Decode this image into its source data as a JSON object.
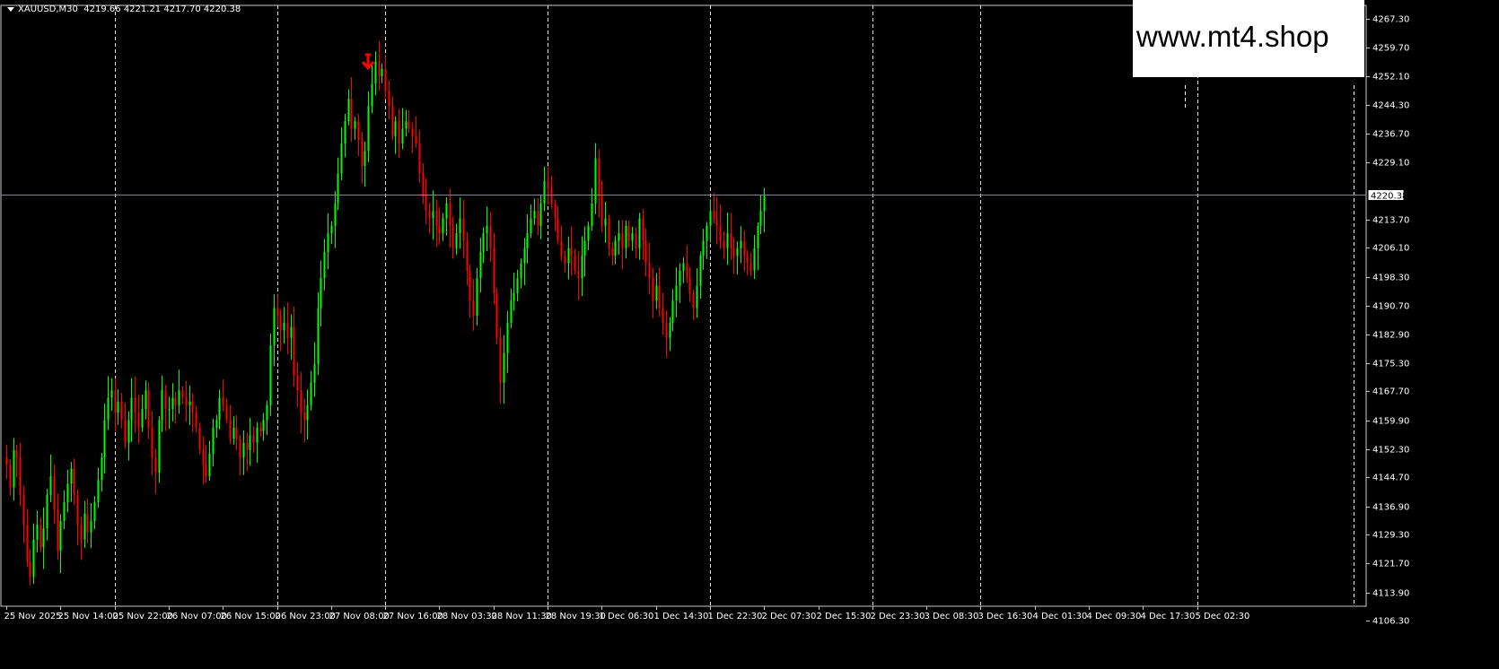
{
  "header": {
    "symbol": "XAUUSD,M30",
    "ohlc": "4219.66 4221.21 4217.70 4220.38"
  },
  "watermark": {
    "text": "www.mt4.shop"
  },
  "colors": {
    "background": "#000000",
    "bull": "#00ff00",
    "bear": "#ff0000",
    "grid": "#ffffff",
    "bid_line": "#778899",
    "axis_text": "#ffffff",
    "arrow": "#ff0000"
  },
  "chart_data": {
    "type": "candlestick",
    "symbol": "XAUUSD",
    "timeframe": "M30",
    "current_price": 4220.38,
    "current_price_label": "4220.38",
    "ylim": [
      4110.2,
      4271.0
    ],
    "grid": "vertical-dashed",
    "y_ticks": [
      "4267.30",
      "4259.70",
      "4252.10",
      "4244.30",
      "4236.70",
      "4229.10",
      "4213.70",
      "4206.10",
      "4198.30",
      "4190.70",
      "4182.90",
      "4175.30",
      "4167.70",
      "4159.90",
      "4152.30",
      "4144.70",
      "4136.90",
      "4129.30",
      "4121.70",
      "4113.90",
      "4106.30"
    ],
    "x_ticks": [
      "25 Nov 2025",
      "25 Nov 14:00",
      "25 Nov 22:00",
      "26 Nov 07:00",
      "26 Nov 15:00",
      "26 Nov 23:00",
      "27 Nov 08:00",
      "27 Nov 16:00",
      "28 Nov 03:30",
      "28 Nov 11:30",
      "28 Nov 19:30",
      "1 Dec 06:30",
      "1 Dec 14:30",
      "1 Dec 22:30",
      "2 Dec 07:30",
      "2 Dec 15:30",
      "2 Dec 23:30",
      "3 Dec 08:30",
      "3 Dec 16:30",
      "4 Dec 01:30",
      "4 Dec 09:30",
      "4 Dec 17:30",
      "5 Dec 02:30"
    ],
    "grid_x_ticks": [
      "25 Nov 22:00",
      "26 Nov 23:00",
      "27 Nov 16:00",
      "28 Nov 19:30",
      "1 Dec 22:30",
      "2 Dec 23:30",
      "3 Dec 16:30",
      "5 Dec 02:30"
    ],
    "candles_per_tick": 16,
    "series_close": [
      4148,
      4142,
      4152,
      4150,
      4140,
      4132,
      4122,
      4118,
      4128,
      4132,
      4126,
      4131,
      4140,
      4145,
      4136,
      4125,
      4133,
      4138,
      4143,
      4147,
      4140,
      4132,
      4128,
      4135,
      4130,
      4133,
      4138,
      4144,
      4150,
      4160,
      4166,
      4168,
      4162,
      4165,
      4160,
      4154,
      4160,
      4166,
      4162,
      4158,
      4163,
      4168,
      4158,
      4150,
      4146,
      4160,
      4168,
      4163,
      4163,
      4166,
      4164,
      4168,
      4166,
      4164,
      4165,
      4162,
      4158,
      4152,
      4148,
      4145,
      4151,
      4158,
      4160,
      4166,
      4164,
      4160,
      4155,
      4158,
      4155,
      4150,
      4154,
      4152,
      4156,
      4154,
      4158,
      4157,
      4160,
      4164,
      4180,
      4190,
      4188,
      4184,
      4186,
      4182,
      4185,
      4172,
      4168,
      4162,
      4160,
      4164,
      4170,
      4175,
      4190,
      4198,
      4205,
      4210,
      4212,
      4218,
      4226,
      4234,
      4240,
      4246,
      4238,
      4240,
      4235,
      4228,
      4232,
      4244,
      4250,
      4256,
      4252,
      4254,
      4248,
      4244,
      4236,
      4240,
      4234,
      4238,
      4240,
      4238,
      4236,
      4234,
      4226,
      4220,
      4216,
      4214,
      4216,
      4212,
      4210,
      4214,
      4218,
      4212,
      4206,
      4210,
      4214,
      4208,
      4200,
      4192,
      4188,
      4198,
      4205,
      4210,
      4212,
      4206,
      4194,
      4182,
      4170,
      4178,
      4186,
      4192,
      4194,
      4198,
      4202,
      4206,
      4210,
      4214,
      4216,
      4212,
      4218,
      4224,
      4222,
      4218,
      4214,
      4208,
      4204,
      4202,
      4206,
      4204,
      4200,
      4198,
      4204,
      4208,
      4212,
      4218,
      4230,
      4220,
      4212,
      4214,
      4206,
      4204,
      4208,
      4210,
      4206,
      4212,
      4208,
      4210,
      4206,
      4214,
      4208,
      4202,
      4198,
      4192,
      4196,
      4190,
      4186,
      4182,
      4186,
      4192,
      4196,
      4200,
      4202,
      4198,
      4194,
      4190,
      4196,
      4204,
      4208,
      4212,
      4216,
      4214,
      4212,
      4208,
      4206,
      4210,
      4206,
      4204,
      4206,
      4208,
      4204,
      4202,
      4200,
      4206,
      4212,
      4216,
      4220
    ],
    "sell_arrow_label": "sell-signal"
  }
}
